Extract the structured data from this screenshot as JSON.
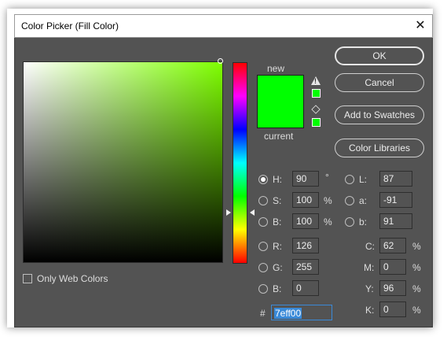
{
  "window": {
    "title": "Color Picker (Fill Color)",
    "close_glyph": "✕"
  },
  "colors": {
    "new": "#00ff00",
    "current": "#00ff00",
    "selected_hex": "#7eff00"
  },
  "preview": {
    "new_label": "new",
    "current_label": "current"
  },
  "buttons": {
    "ok": "OK",
    "cancel": "Cancel",
    "add_to_swatches": "Add to Swatches",
    "color_libraries": "Color Libraries"
  },
  "hsb": {
    "h": {
      "label": "H:",
      "value": "90",
      "unit": "°"
    },
    "s": {
      "label": "S:",
      "value": "100",
      "unit": "%"
    },
    "b": {
      "label": "B:",
      "value": "100",
      "unit": "%"
    }
  },
  "rgb": {
    "r": {
      "label": "R:",
      "value": "126"
    },
    "g": {
      "label": "G:",
      "value": "255"
    },
    "b": {
      "label": "B:",
      "value": "0"
    }
  },
  "lab": {
    "l": {
      "label": "L:",
      "value": "87"
    },
    "a": {
      "label": "a:",
      "value": "-91"
    },
    "b": {
      "label": "b:",
      "value": "91"
    }
  },
  "cmyk": {
    "c": {
      "label": "C:",
      "value": "62",
      "unit": "%"
    },
    "m": {
      "label": "M:",
      "value": "0",
      "unit": "%"
    },
    "y": {
      "label": "Y:",
      "value": "96",
      "unit": "%"
    },
    "k": {
      "label": "K:",
      "value": "0",
      "unit": "%"
    }
  },
  "hex": {
    "label": "#",
    "value": "7eff00"
  },
  "only_web_colors": {
    "label": "Only Web Colors",
    "checked": false
  },
  "icons": {
    "gamut_warning": "warning-triangle-icon",
    "web_safe": "cube-icon"
  }
}
